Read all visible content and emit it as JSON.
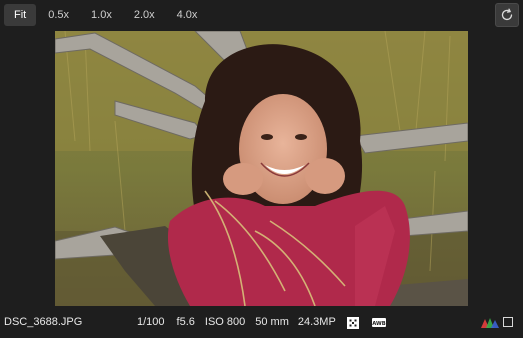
{
  "zoom": {
    "options": [
      "Fit",
      "0.5x",
      "1.0x",
      "2.0x",
      "4.0x"
    ],
    "selected": "Fit"
  },
  "toolbar": {
    "refresh_icon": "refresh-icon"
  },
  "photo": {
    "icon": "photo-image"
  },
  "status": {
    "filename": "DSC_3688.JPG",
    "shutter": "1/100",
    "aperture": "f5.6",
    "iso": "ISO 800",
    "focal_length": "50 mm",
    "megapixels": "24.3MP",
    "awb_label": "AWB"
  },
  "colors": {
    "background": "#1e1e1e",
    "active_button": "#3a3a3a",
    "text": "#e6e6e6"
  }
}
